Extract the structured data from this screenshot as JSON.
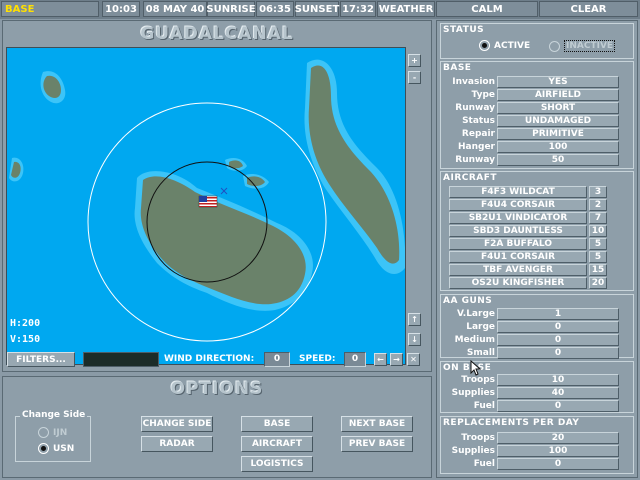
{
  "topbar": {
    "base_label": "BASE",
    "time": "10:03",
    "date": "08 MAY 40",
    "sunrise_label": "SUNRISE",
    "sunrise_time": "06:35",
    "sunset_label": "SUNSET",
    "sunset_time": "17:32",
    "weather_label": "WEATHER",
    "weather_wind": "CALM",
    "weather_sky": "CLEAR"
  },
  "map": {
    "title": "GUADALCANAL",
    "h_label": "H:200",
    "v_label": "V:150",
    "zoom_in": "+",
    "zoom_out": "-",
    "scroll_up": "↑",
    "scroll_down": "↓",
    "filters_label": "FILTERS...",
    "wind_direction_label": "WIND DIRECTION:",
    "wind_direction_value": "0",
    "speed_label": "SPEED:",
    "speed_value": "0",
    "nav_left": "←",
    "nav_right": "→",
    "nav_x": "✕",
    "colors": {
      "ocean": "#00a8f0",
      "shallow": "#3cc4f8",
      "land": "#6a826a"
    }
  },
  "options": {
    "title": "OPTIONS",
    "change_side_group": "Change Side",
    "side_options": [
      "IJN",
      "USN"
    ],
    "selected_side": "USN",
    "buttons": {
      "change_side": "CHANGE SIDE",
      "radar": "RADAR",
      "base": "BASE",
      "aircraft": "AIRCRAFT",
      "logistics": "LOGISTICS",
      "next_base": "NEXT BASE",
      "prev_base": "PREV BASE"
    }
  },
  "status": {
    "heading": "STATUS",
    "active_label": "ACTIVE",
    "inactive_label": "INACTIVE",
    "selected": "ACTIVE"
  },
  "base": {
    "heading": "BASE",
    "rows": [
      {
        "label": "Invasion",
        "value": "YES"
      },
      {
        "label": "Type",
        "value": "AIRFIELD"
      },
      {
        "label": "Runway",
        "value": "SHORT"
      },
      {
        "label": "Status",
        "value": "UNDAMAGED"
      },
      {
        "label": "Repair",
        "value": "PRIMITIVE"
      },
      {
        "label": "Hanger",
        "value": "100"
      },
      {
        "label": "Runway",
        "value": "50"
      }
    ]
  },
  "aircraft": {
    "heading": "AIRCRAFT",
    "rows": [
      {
        "name": "F4F3 WILDCAT",
        "count": "3"
      },
      {
        "name": "F4U4 CORSAIR",
        "count": "2"
      },
      {
        "name": "SB2U1 VINDICATOR",
        "count": "7"
      },
      {
        "name": "SBD3 DAUNTLESS",
        "count": "10"
      },
      {
        "name": "F2A BUFFALO",
        "count": "5"
      },
      {
        "name": "F4U1 CORSAIR",
        "count": "5"
      },
      {
        "name": "TBF AVENGER",
        "count": "15"
      },
      {
        "name": "OS2U KINGFISHER",
        "count": "20"
      }
    ]
  },
  "aa_guns": {
    "heading": "AA GUNS",
    "rows": [
      {
        "label": "V.Large",
        "value": "1"
      },
      {
        "label": "Large",
        "value": "0"
      },
      {
        "label": "Medium",
        "value": "0"
      },
      {
        "label": "Small",
        "value": "0"
      }
    ]
  },
  "on_base": {
    "heading": "ON BASE",
    "rows": [
      {
        "label": "Troops",
        "value": "10"
      },
      {
        "label": "Supplies",
        "value": "40"
      },
      {
        "label": "Fuel",
        "value": "0"
      }
    ]
  },
  "replacements": {
    "heading": "REPLACEMENTS PER DAY",
    "rows": [
      {
        "label": "Troops",
        "value": "20"
      },
      {
        "label": "Supplies",
        "value": "100"
      },
      {
        "label": "Fuel",
        "value": "0"
      }
    ]
  }
}
